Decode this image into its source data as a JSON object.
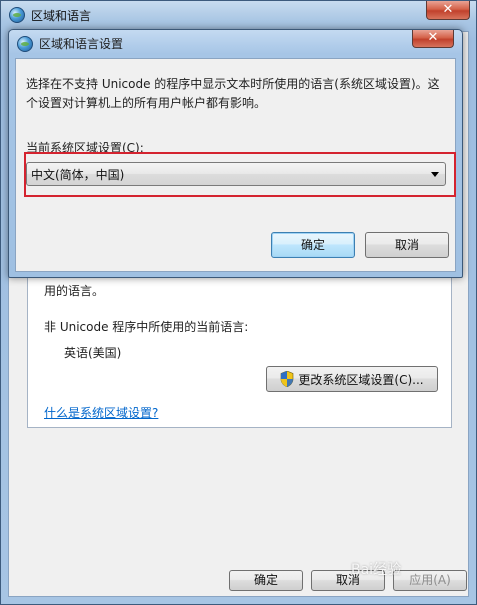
{
  "back_window": {
    "title": "区域和语言",
    "close_label": "✕",
    "panel": {
      "partial_text": "用的语言。",
      "current_language_label": "非 Unicode 程序中所使用的当前语言:",
      "current_language_value": "英语(美国)",
      "change_button_label": "更改系统区域设置(C)...",
      "help_link": "什么是系统区域设置?"
    },
    "buttons": {
      "ok": "确定",
      "cancel": "取消",
      "apply": "应用(A)"
    }
  },
  "dialog": {
    "title": "区域和语言设置",
    "close_label": "✕",
    "description": "选择在不支持 Unicode 的程序中显示文本时所使用的语言(系统区域设置)。这个设置对计算机上的所有用户帐户都有影响。",
    "locale_label": "当前系统区域设置(C):",
    "locale_value": "中文(简体，中国)",
    "ok_label": "确定",
    "cancel_label": "取消"
  },
  "colors": {
    "highlight": "#d4232f",
    "link": "#0066cc"
  },
  "watermark": "Bai经验"
}
